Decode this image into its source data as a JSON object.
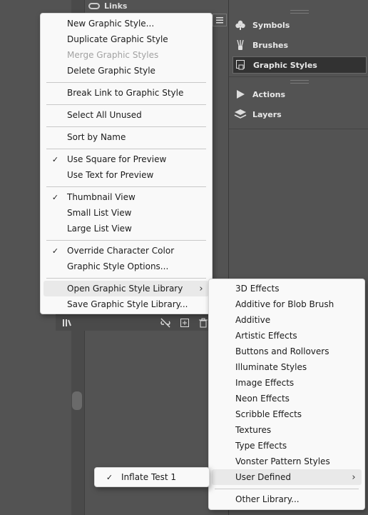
{
  "panel": {
    "links_label": "Links"
  },
  "dock": {
    "items": [
      {
        "label": "Symbols",
        "icon": "club-icon"
      },
      {
        "label": "Brushes",
        "icon": "brush-icon"
      },
      {
        "label": "Graphic Styles",
        "icon": "graphic-styles-icon",
        "active": true
      },
      {
        "label": "Actions",
        "icon": "play-icon"
      },
      {
        "label": "Layers",
        "icon": "layers-icon"
      }
    ]
  },
  "main_menu": {
    "items": [
      {
        "label": "New Graphic Style..."
      },
      {
        "label": "Duplicate Graphic Style"
      },
      {
        "label": "Merge Graphic Styles",
        "disabled": true
      },
      {
        "label": "Delete Graphic Style"
      },
      {
        "label": "Break Link to Graphic Style"
      },
      {
        "label": "Select All Unused"
      },
      {
        "label": "Sort by Name"
      },
      {
        "label": "Use Square for Preview",
        "checked": true
      },
      {
        "label": "Use Text for Preview"
      },
      {
        "label": "Thumbnail View",
        "checked": true
      },
      {
        "label": "Small List View"
      },
      {
        "label": "Large List View"
      },
      {
        "label": "Override Character Color",
        "checked": true
      },
      {
        "label": "Graphic Style Options..."
      },
      {
        "label": "Open Graphic Style Library",
        "submenu": true
      },
      {
        "label": "Save Graphic Style Library..."
      }
    ]
  },
  "library_menu": {
    "items": [
      {
        "label": "3D Effects"
      },
      {
        "label": "Additive for Blob Brush"
      },
      {
        "label": "Additive"
      },
      {
        "label": "Artistic Effects"
      },
      {
        "label": "Buttons and Rollovers"
      },
      {
        "label": "Illuminate Styles"
      },
      {
        "label": "Image Effects"
      },
      {
        "label": "Neon Effects"
      },
      {
        "label": "Scribble Effects"
      },
      {
        "label": "Textures"
      },
      {
        "label": "Type Effects"
      },
      {
        "label": "Vonster Pattern Styles"
      },
      {
        "label": "User Defined",
        "submenu": true
      },
      {
        "label": "Other Library..."
      }
    ]
  },
  "user_menu": {
    "items": [
      {
        "label": "Inflate Test 1",
        "checked": true
      }
    ]
  },
  "glyphs": {
    "check": "✓",
    "arrow": "›"
  }
}
